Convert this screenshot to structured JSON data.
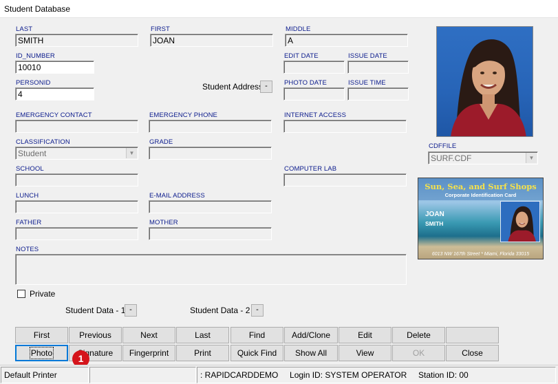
{
  "window": {
    "title": "Student Database"
  },
  "fields": {
    "last": {
      "label": "LAST",
      "value": "SMITH"
    },
    "first": {
      "label": "FIRST",
      "value": "JOAN"
    },
    "middle": {
      "label": "MIDDLE",
      "value": "A"
    },
    "id_number": {
      "label": "ID_NUMBER",
      "value": "10010"
    },
    "edit_date": {
      "label": "EDIT DATE",
      "value": ""
    },
    "issue_date": {
      "label": "ISSUE DATE",
      "value": ""
    },
    "personid": {
      "label": "PERSONID",
      "value": "4"
    },
    "photo_date": {
      "label": "PHOTO DATE",
      "value": ""
    },
    "issue_time": {
      "label": "ISSUE TIME",
      "value": ""
    },
    "emergency_contact": {
      "label": "EMERGENCY CONTACT",
      "value": ""
    },
    "emergency_phone": {
      "label": "EMERGENCY PHONE",
      "value": ""
    },
    "internet_access": {
      "label": "INTERNET ACCESS",
      "value": ""
    },
    "classification": {
      "label": "CLASSIFICATION",
      "value": "Student"
    },
    "grade": {
      "label": "GRADE",
      "value": ""
    },
    "school": {
      "label": "SCHOOL",
      "value": ""
    },
    "computer_lab": {
      "label": "COMPUTER LAB",
      "value": ""
    },
    "lunch": {
      "label": "LUNCH",
      "value": ""
    },
    "email": {
      "label": "E-MAIL ADDRESS",
      "value": ""
    },
    "father": {
      "label": "FATHER",
      "value": ""
    },
    "mother": {
      "label": "MOTHER",
      "value": ""
    },
    "notes": {
      "label": "NOTES",
      "value": ""
    },
    "cdffile": {
      "label": "CDFFILE",
      "value": "SURF.CDF"
    }
  },
  "student_address": {
    "label": "Student Address",
    "button": "-"
  },
  "private": {
    "label": "Private",
    "checked": false
  },
  "student_data_1": {
    "label": "Student Data - 1",
    "button": "-"
  },
  "student_data_2": {
    "label": "Student Data - 2",
    "button": "-"
  },
  "photo": {
    "icon": "student-portrait"
  },
  "card": {
    "title": "Sun, Sea, and Surf Shops",
    "subtitle": "Corporate Identification Card",
    "first_name": "JOAN",
    "last_name": "SMITH",
    "address": "6013 NW 167th Street * Miami, Florida 33015"
  },
  "buttons_row1": [
    "First",
    "Previous",
    "Next",
    "Last",
    "Find",
    "Add/Clone",
    "Edit",
    "Delete",
    ""
  ],
  "buttons_row2": [
    "Photo",
    "Signature",
    "Fingerprint",
    "Print",
    "Quick Find",
    "Show All",
    "View",
    "OK",
    "Close"
  ],
  "badge": "1",
  "status": {
    "printer": "Default Printer",
    "blank": "",
    "database": ": RAPIDCARDDEMO",
    "login": "Login ID:  SYSTEM OPERATOR",
    "station": "Station ID:  00"
  },
  "colors": {
    "label_blue": "#0a1a8c",
    "badge_red": "#d5141b",
    "focus_blue": "#0078d7"
  }
}
